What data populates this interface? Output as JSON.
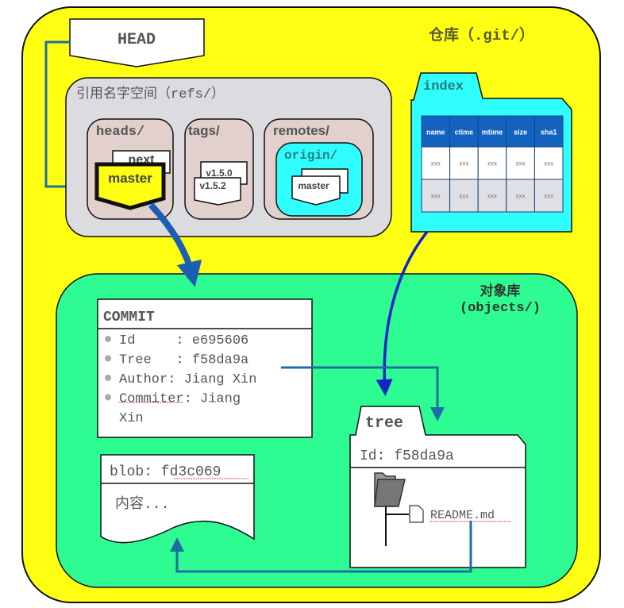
{
  "repo": {
    "label": "仓库（.git/）",
    "color": "#ffff14"
  },
  "head": {
    "label": "HEAD"
  },
  "refs": {
    "label": "引用名字空间（refs/）",
    "heads": {
      "label": "heads/",
      "branches": [
        "next",
        "master"
      ],
      "active": "master"
    },
    "tags": {
      "label": "tags/",
      "items": [
        "v1.5.0",
        "v1.5.2"
      ]
    },
    "remotes": {
      "label": "remotes/",
      "origin": {
        "label": "origin/",
        "branches": [
          "master"
        ]
      }
    }
  },
  "index": {
    "label": "index",
    "columns": [
      "name",
      "ctime",
      "mtime",
      "size",
      "sha1"
    ],
    "rows": [
      [
        "xxx",
        "xxx",
        "xxx",
        "xxx",
        "xxx"
      ],
      [
        "xxx",
        "xxx",
        "xxx",
        "xxx",
        "xxx"
      ]
    ]
  },
  "objects": {
    "label_line1": "对象库",
    "label_line2": "(objects/)",
    "commit": {
      "title": "COMMIT",
      "fields": [
        {
          "line": "Id     : e695606"
        },
        {
          "line": "Tree   : f58da9a"
        },
        {
          "line": "Author: Jiang Xin"
        },
        {
          "line": "Commiter: Jiang",
          "cont": "Xin"
        }
      ]
    },
    "blob": {
      "title": "blob: fd3c069",
      "content": "内容..."
    },
    "tree": {
      "tab": "tree",
      "id": "Id: f58da9a",
      "file": "README.md"
    }
  },
  "colors": {
    "yellow": "#ffff14",
    "green": "#2efc92",
    "refs_gray": "#dcdce0",
    "ref_pink": "#e2d0cd",
    "cyan": "#30fefe",
    "table_header": "#1462c0",
    "arrow_blue": "#1a5fb4",
    "arrow_navy": "#1025c8",
    "arrow_teal": "#1c6fa0"
  }
}
